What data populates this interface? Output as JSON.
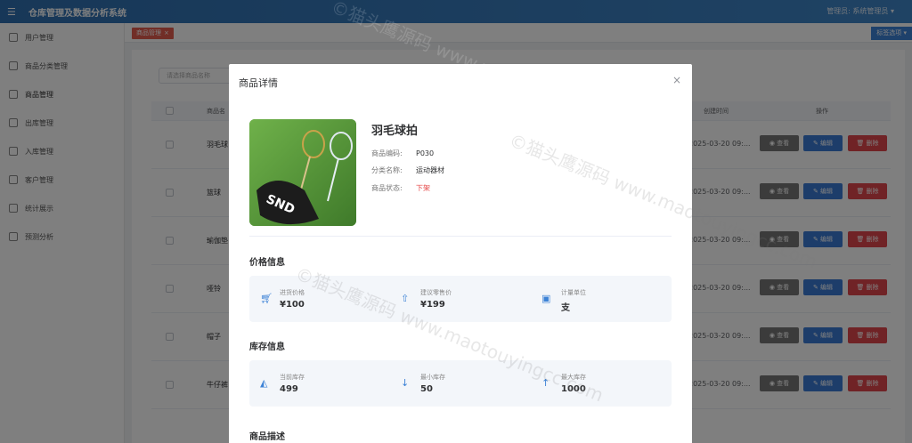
{
  "header": {
    "app_title": "仓库管理及数据分析系统",
    "user": "管理员: 系统管理员"
  },
  "sidebar": {
    "items": [
      {
        "label": "用户管理"
      },
      {
        "label": "商品分类管理"
      },
      {
        "label": "商品管理"
      },
      {
        "label": "出库管理"
      },
      {
        "label": "入库管理"
      },
      {
        "label": "客户管理"
      },
      {
        "label": "统计展示"
      },
      {
        "label": "预测分析"
      }
    ]
  },
  "tabs": {
    "active": "商品管理",
    "options_label": "标签选项"
  },
  "list": {
    "search_placeholder": "请选择商品名称",
    "headers": {
      "name": "商品名",
      "created": "创建时间",
      "actions": "操作"
    },
    "rows": [
      {
        "name": "羽毛球",
        "created": "2025-03-20 09:..."
      },
      {
        "name": "篮球",
        "created": "2025-03-20 09:..."
      },
      {
        "name": "瑜伽垫",
        "created": "2025-03-20 09:..."
      },
      {
        "name": "哑铃",
        "created": "2025-03-20 09:..."
      },
      {
        "name": "帽子",
        "created": "2025-03-20 09:..."
      },
      {
        "name": "牛仔裤",
        "created": "2025-03-20 09:..."
      }
    ],
    "view_label": "查看",
    "edit_label": "编辑",
    "delete_label": "删除"
  },
  "dialog": {
    "title": "商品详情",
    "product": {
      "name": "羽毛球拍",
      "code_label": "商品编码:",
      "code": "P030",
      "category_label": "分类名称:",
      "category": "运动器材",
      "status_label": "商品状态:",
      "status": "下架",
      "status_color": "#e54a4a"
    },
    "price_section": {
      "title": "价格信息",
      "items": [
        {
          "label": "进货价格",
          "value": "¥100",
          "icon": "cart-icon"
        },
        {
          "label": "建议零售价",
          "value": "¥199",
          "icon": "bag-up-icon"
        },
        {
          "label": "计量单位",
          "value": "支",
          "icon": "box-icon"
        }
      ]
    },
    "stock_section": {
      "title": "库存信息",
      "items": [
        {
          "label": "当前库存",
          "value": "499",
          "icon": "bag-icon"
        },
        {
          "label": "最小库存",
          "value": "50",
          "icon": "arrow-down-icon"
        },
        {
          "label": "最大库存",
          "value": "1000",
          "icon": "arrow-up-icon"
        }
      ]
    },
    "desc_section": {
      "title": "商品描述"
    }
  },
  "watermark_text": "©猫头鹰源码 www.maotouyingcc.com",
  "colors": {
    "header": "#3f86c8",
    "primary": "#3a7bd5",
    "danger": "#e0464c",
    "neutral": "#767676"
  }
}
